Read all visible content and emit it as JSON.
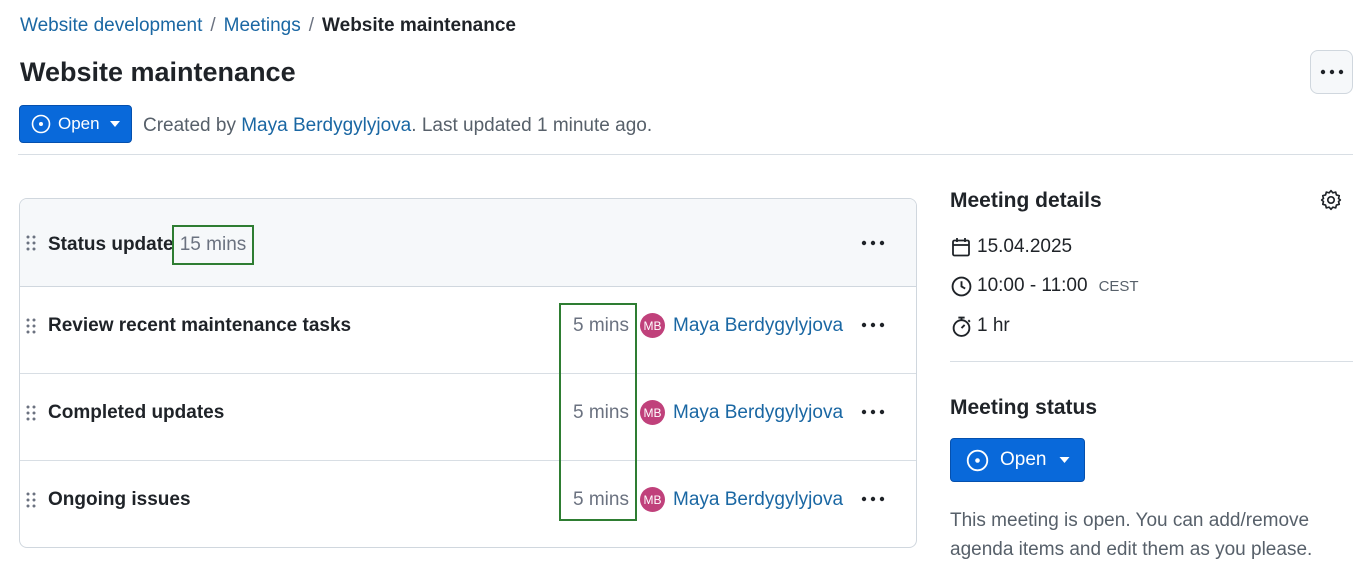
{
  "breadcrumb": {
    "items": [
      "Website development",
      "Meetings"
    ],
    "separator": "/",
    "current": "Website maintenance"
  },
  "page": {
    "title": "Website maintenance",
    "more_icon": "ellipsis-icon"
  },
  "meta": {
    "status_label": "Open",
    "created_prefix": "Created by ",
    "author": "Maya Berdygylyjova",
    "updated_suffix": ". Last updated 1 minute ago."
  },
  "agenda": {
    "section": {
      "title": "Status update",
      "duration": "15 mins"
    },
    "items": [
      {
        "title": "Review recent maintenance tasks",
        "duration": "5 mins",
        "avatar": "MB",
        "presenter": "Maya Berdygylyjova"
      },
      {
        "title": "Completed updates",
        "duration": "5 mins",
        "avatar": "MB",
        "presenter": "Maya Berdygylyjova"
      },
      {
        "title": "Ongoing issues",
        "duration": "5 mins",
        "avatar": "MB",
        "presenter": "Maya Berdygylyjova"
      }
    ]
  },
  "details": {
    "title": "Meeting details",
    "date": "15.04.2025",
    "time": "10:00 - 11:00",
    "timezone": "CEST",
    "duration": "1 hr"
  },
  "status": {
    "title": "Meeting status",
    "button_label": "Open",
    "description": "This meeting is open. You can add/remove agenda items and edit them as you please."
  },
  "colors": {
    "primary": "#0969da",
    "link": "#1a67a3",
    "avatar": "#c0417b",
    "highlight": "#2e7d32"
  }
}
